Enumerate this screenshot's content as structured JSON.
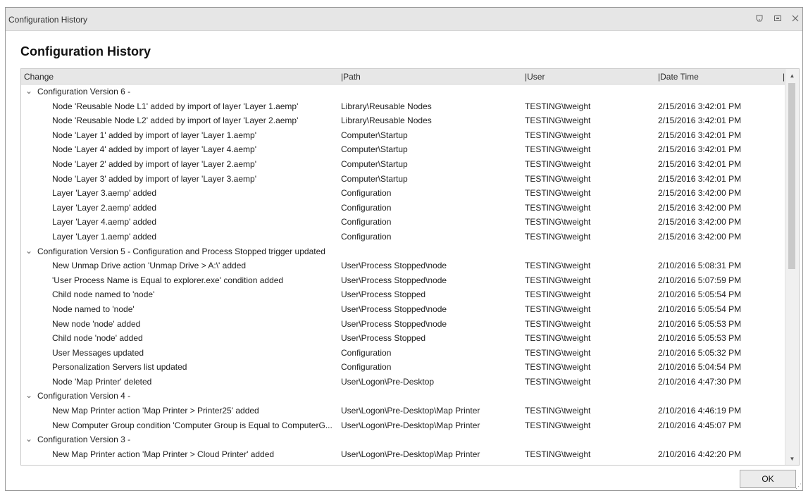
{
  "window": {
    "title": "Configuration History",
    "heading": "Configuration History"
  },
  "titlebar_icons": [
    "help-icon",
    "maximize-icon",
    "close-icon"
  ],
  "grid": {
    "headers": [
      "Change",
      "|Path",
      "|User",
      "|Date Time",
      "|"
    ],
    "groups": [
      {
        "label": "Configuration Version 6 -",
        "rows": [
          [
            "Node 'Reusable Node L1' added by import of layer 'Layer 1.aemp'",
            "Library\\Reusable Nodes",
            "TESTING\\tweight",
            "2/15/2016 3:42:01 PM"
          ],
          [
            "Node 'Reusable Node L2' added by import of layer 'Layer 2.aemp'",
            "Library\\Reusable Nodes",
            "TESTING\\tweight",
            "2/15/2016 3:42:01 PM"
          ],
          [
            "Node 'Layer 1' added by import of layer 'Layer 1.aemp'",
            "Computer\\Startup",
            "TESTING\\tweight",
            "2/15/2016 3:42:01 PM"
          ],
          [
            "Node 'Layer 4' added by import of layer 'Layer 4.aemp'",
            "Computer\\Startup",
            "TESTING\\tweight",
            "2/15/2016 3:42:01 PM"
          ],
          [
            "Node 'Layer 2' added by import of layer 'Layer 2.aemp'",
            "Computer\\Startup",
            "TESTING\\tweight",
            "2/15/2016 3:42:01 PM"
          ],
          [
            "Node 'Layer 3' added by import of layer 'Layer 3.aemp'",
            "Computer\\Startup",
            "TESTING\\tweight",
            "2/15/2016 3:42:01 PM"
          ],
          [
            "Layer 'Layer 3.aemp' added",
            "Configuration",
            "TESTING\\tweight",
            "2/15/2016 3:42:00 PM"
          ],
          [
            "Layer 'Layer 2.aemp' added",
            "Configuration",
            "TESTING\\tweight",
            "2/15/2016 3:42:00 PM"
          ],
          [
            "Layer 'Layer 4.aemp' added",
            "Configuration",
            "TESTING\\tweight",
            "2/15/2016 3:42:00 PM"
          ],
          [
            "Layer 'Layer 1.aemp' added",
            "Configuration",
            "TESTING\\tweight",
            "2/15/2016 3:42:00 PM"
          ]
        ]
      },
      {
        "label": "Configuration Version 5 - Configuration and Process Stopped trigger updated",
        "rows": [
          [
            "New Unmap Drive action 'Unmap Drive > A:\\' added",
            "User\\Process Stopped\\node",
            "TESTING\\tweight",
            "2/10/2016 5:08:31 PM"
          ],
          [
            "'User Process Name is Equal to explorer.exe' condition added",
            "User\\Process Stopped\\node",
            "TESTING\\tweight",
            "2/10/2016 5:07:59 PM"
          ],
          [
            "Child node named to 'node'",
            "User\\Process Stopped",
            "TESTING\\tweight",
            "2/10/2016 5:05:54 PM"
          ],
          [
            "Node named to 'node'",
            "User\\Process Stopped\\node",
            "TESTING\\tweight",
            "2/10/2016 5:05:54 PM"
          ],
          [
            "New node 'node' added",
            "User\\Process Stopped\\node",
            "TESTING\\tweight",
            "2/10/2016 5:05:53 PM"
          ],
          [
            "Child node 'node' added",
            "User\\Process Stopped",
            "TESTING\\tweight",
            "2/10/2016 5:05:53 PM"
          ],
          [
            "User Messages updated",
            "Configuration",
            "TESTING\\tweight",
            "2/10/2016 5:05:32 PM"
          ],
          [
            "Personalization Servers list updated",
            "Configuration",
            "TESTING\\tweight",
            "2/10/2016 5:04:54 PM"
          ],
          [
            "Node 'Map Printer' deleted",
            "User\\Logon\\Pre-Desktop",
            "TESTING\\tweight",
            "2/10/2016 4:47:30 PM"
          ]
        ]
      },
      {
        "label": "Configuration Version 4 -",
        "rows": [
          [
            "New Map Printer action 'Map Printer > Printer25' added",
            "User\\Logon\\Pre-Desktop\\Map Printer",
            "TESTING\\tweight",
            "2/10/2016 4:46:19 PM"
          ],
          [
            "New Computer Group condition 'Computer Group is Equal to ComputerG...",
            "User\\Logon\\Pre-Desktop\\Map Printer",
            "TESTING\\tweight",
            "2/10/2016 4:45:07 PM"
          ]
        ]
      },
      {
        "label": "Configuration Version 3 -",
        "rows": [
          [
            "New Map Printer action 'Map Printer > Cloud Printer' added",
            "User\\Logon\\Pre-Desktop\\Map Printer",
            "TESTING\\tweight",
            "2/10/2016 4:42:20 PM"
          ]
        ]
      }
    ]
  },
  "footer": {
    "ok_label": "OK"
  }
}
